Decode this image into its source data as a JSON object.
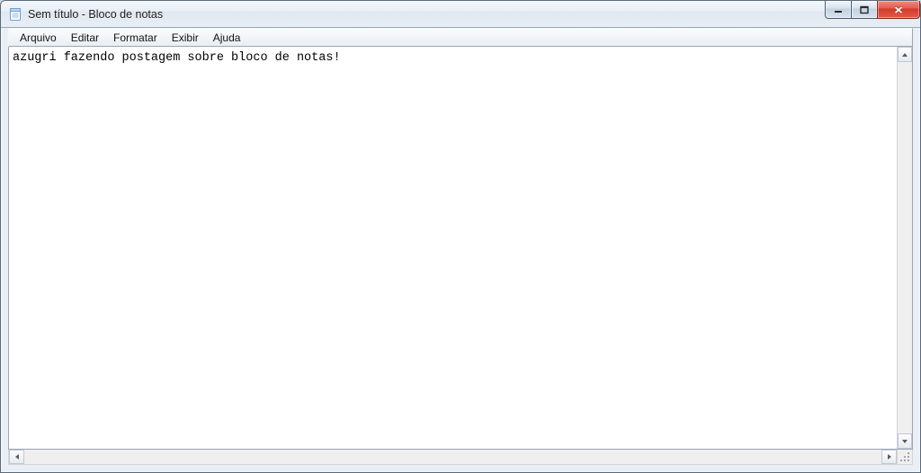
{
  "window": {
    "title": "Sem título - Bloco de notas",
    "icon": "notepad-icon"
  },
  "menubar": {
    "items": [
      {
        "label": "Arquivo"
      },
      {
        "label": "Editar"
      },
      {
        "label": "Formatar"
      },
      {
        "label": "Exibir"
      },
      {
        "label": "Ajuda"
      }
    ]
  },
  "editor": {
    "content": "azugri fazendo postagem sobre bloco de notas!"
  },
  "winbuttons": {
    "minimize": "minimize",
    "maximize": "maximize",
    "close": "close"
  }
}
